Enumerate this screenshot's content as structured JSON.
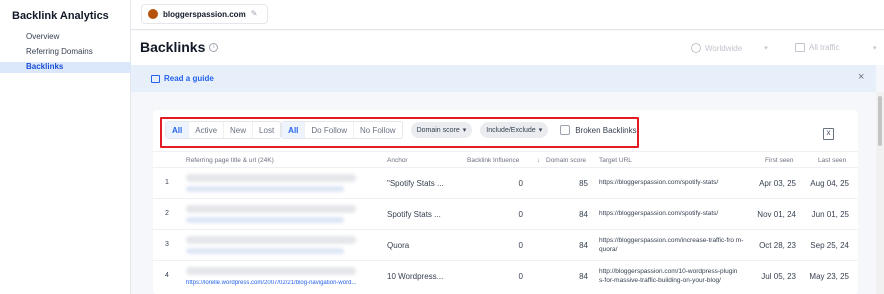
{
  "sidebar": {
    "brand": "Backlink Analytics",
    "items": [
      {
        "label": "Overview",
        "active": false
      },
      {
        "label": "Referring Domains",
        "active": false
      },
      {
        "label": "Backlinks",
        "active": true
      }
    ]
  },
  "topbar": {
    "domain": "bloggerspassion.com"
  },
  "header": {
    "title": "Backlinks",
    "region": "Worldwide",
    "traffic": "All traffic"
  },
  "guide": {
    "label": "Read a guide"
  },
  "filters": {
    "status": [
      "All",
      "Active",
      "New",
      "Lost"
    ],
    "follow": [
      "All",
      "Do Follow",
      "No Follow"
    ],
    "domain_score": "Domain score",
    "include_exclude": "Include/Exclude",
    "broken": "Broken Backlinks"
  },
  "table": {
    "headers": {
      "page": "Referring page title & url (24K)",
      "anchor": "Anchor",
      "influence": "Backlink Influence",
      "dscore": "Domain score",
      "target": "Target URL",
      "first": "First seen",
      "last": "Last seen"
    },
    "rows": [
      {
        "n": "1",
        "url": "",
        "anchor": "\"Spotify Stats ...",
        "influence": "0",
        "dscore": "85",
        "target": "https://bloggerspassion.com/spotify-stats/",
        "first": "Apr 03, 25",
        "last": "Aug 04, 25"
      },
      {
        "n": "2",
        "url": "",
        "anchor": "Spotify Stats ...",
        "influence": "0",
        "dscore": "84",
        "target": "https://bloggerspassion.com/spotify-stats/",
        "first": "Nov 01, 24",
        "last": "Jun 01, 25"
      },
      {
        "n": "3",
        "url": "",
        "anchor": "Quora",
        "influence": "0",
        "dscore": "84",
        "target": "https://bloggerspassion.com/increase-traffic-fro m-quora/",
        "first": "Oct 28, 23",
        "last": "Sep 25, 24"
      },
      {
        "n": "4",
        "url": "https://lorelle.wordpress.com/2007/02/21/blog-navigation-word...",
        "anchor": "10 Wordpress...",
        "influence": "0",
        "dscore": "84",
        "target": "http://bloggerspassion.com/10-wordpress-plugin s-for-massive-traffic-building-on-your-blog/",
        "first": "Jul 05, 23",
        "last": "May 23, 25"
      }
    ]
  },
  "colors": {
    "accent": "#2563eb",
    "highlight": "#e31b23"
  }
}
